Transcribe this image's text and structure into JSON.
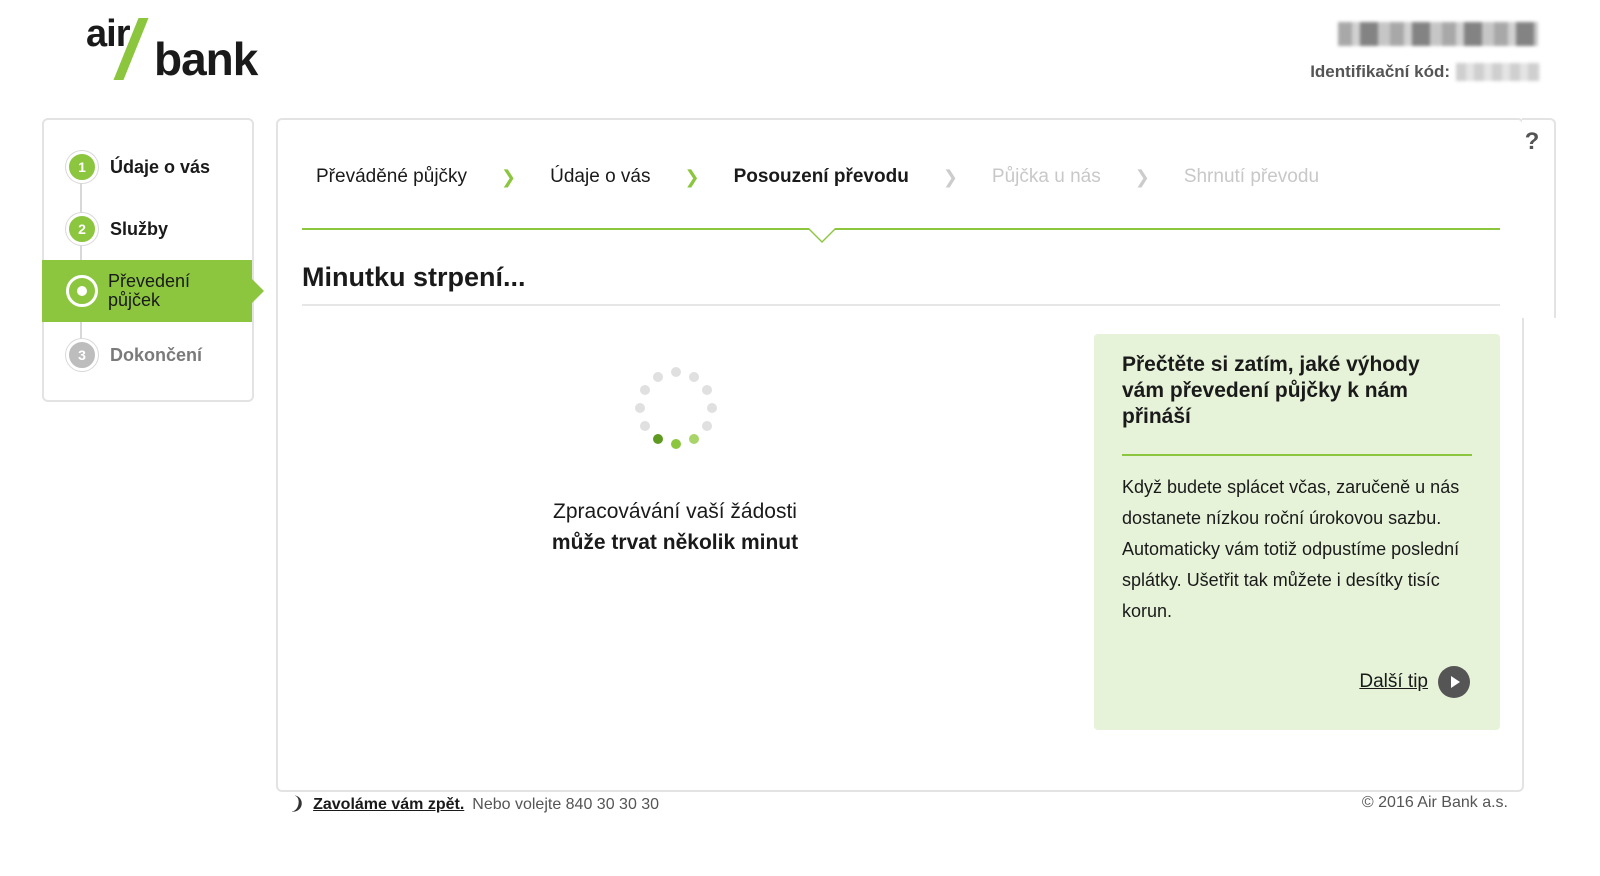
{
  "logo": {
    "part1": "air",
    "part2": "bank"
  },
  "header": {
    "id_label": "Identifikační kód:"
  },
  "steps": [
    {
      "number": "1",
      "label": "Údaje o vás"
    },
    {
      "number": "2",
      "label": "Služby"
    },
    {
      "number": "",
      "label_line1": "Převedení",
      "label_line2": "půjček"
    },
    {
      "number": "3",
      "label": "Dokončení"
    }
  ],
  "breadcrumbs": [
    {
      "label": "Převáděné půjčky"
    },
    {
      "label": "Údaje o vás"
    },
    {
      "label": "Posouzení převodu"
    },
    {
      "label": "Půjčka u nás"
    },
    {
      "label": "Shrnutí převodu"
    }
  ],
  "help_label": "?",
  "main": {
    "title": "Minutku strpení...",
    "processing_line1": "Zpracovávání vaší žádosti",
    "processing_line2": "může trvat několik minut"
  },
  "tip": {
    "title": "Přečtěte si zatím, jaké výhody vám převedení půjčky k nám přináší",
    "text": "Když budete splácet včas, zaručeně u nás dostanete nízkou roční úrokovou sazbu. Automaticky vám totiž odpustíme poslední splátky. Ušetřit tak můžete i desítky tisíc korun.",
    "next_label": "Další tip"
  },
  "footer": {
    "callback_label": "Zavoláme vám zpět.",
    "or_call": "Nebo volejte 840 30 30 30",
    "copyright": "© 2016 Air Bank a.s."
  },
  "colors": {
    "accent": "#8cc63f",
    "tip_bg": "#e6f3d9"
  }
}
